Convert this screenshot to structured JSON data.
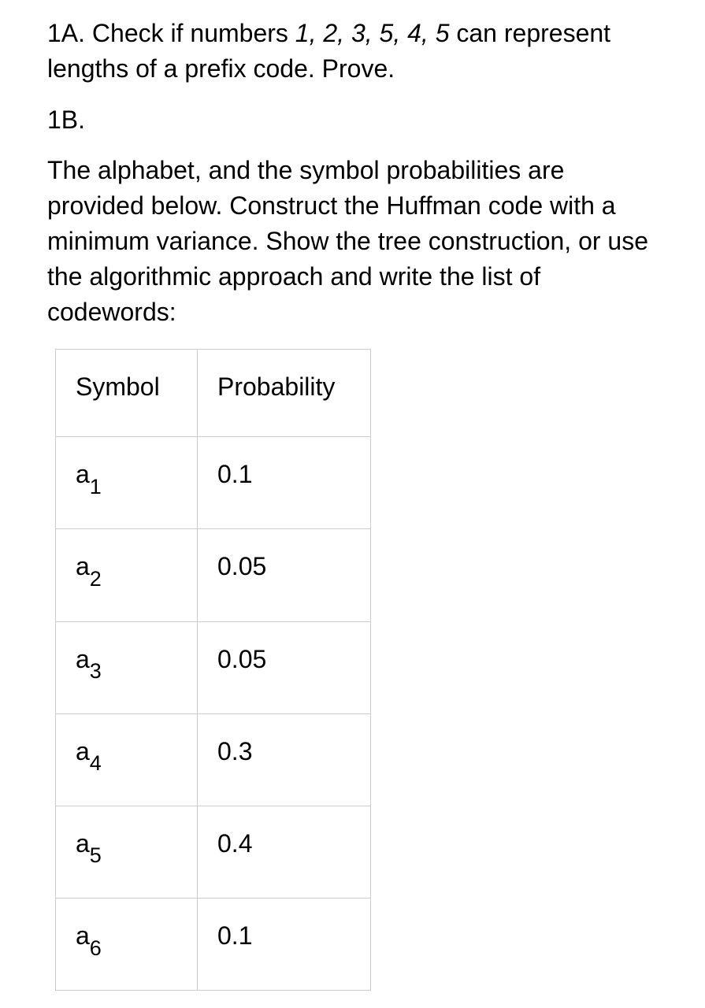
{
  "q1a": {
    "prefix": "1A. Check if numbers ",
    "numbers": "1, 2, 3, 5, 4, 5",
    "suffix": " can represent lengths of a prefix code. Prove."
  },
  "q1b": {
    "label": "1B.",
    "text": "The alphabet, and the symbol probabilities are provided below. Construct the Huffman code with a minimum variance. Show the tree construction, or use the algorithmic approach and write the list of codewords:"
  },
  "table": {
    "headers": {
      "symbol": "Symbol",
      "probability": "Probability"
    },
    "rows": [
      {
        "symbol_base": "a",
        "symbol_sub": "1",
        "probability": "0.1"
      },
      {
        "symbol_base": "a",
        "symbol_sub": "2",
        "probability": "0.05"
      },
      {
        "symbol_base": "a",
        "symbol_sub": "3",
        "probability": "0.05"
      },
      {
        "symbol_base": "a",
        "symbol_sub": "4",
        "probability": "0.3"
      },
      {
        "symbol_base": "a",
        "symbol_sub": "5",
        "probability": "0.4"
      },
      {
        "symbol_base": "a",
        "symbol_sub": "6",
        "probability": "0.1"
      }
    ]
  }
}
